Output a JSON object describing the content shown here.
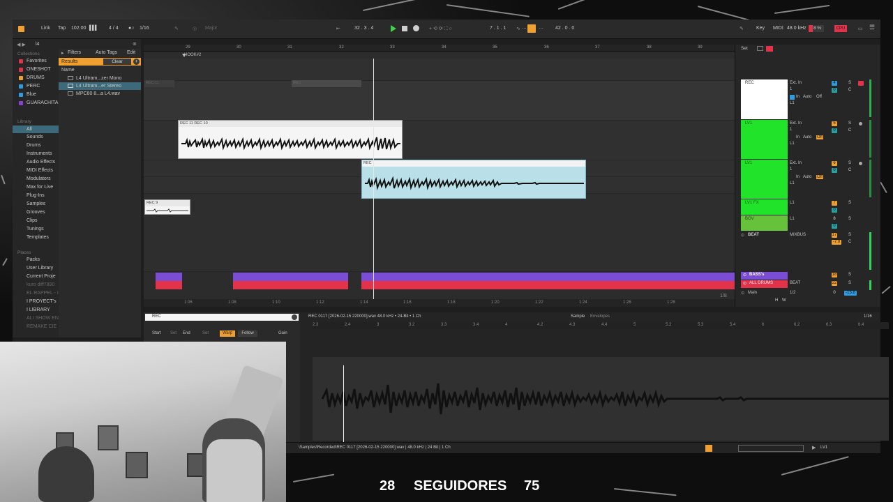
{
  "colors": {
    "accent_orange": "#f0a030",
    "play_green": "#3fd24a",
    "clip_selected_blue": "#b9dfe8",
    "track_white": "#ffffff",
    "track_green": "#21e32a",
    "track_green_dim": "#65c23a",
    "bass_purple": "#7b4cd4",
    "drums_red": "#e2334a",
    "meter_green": "#2fd25a"
  },
  "transport": {
    "link": "Link",
    "tap": "Tap",
    "tempo": "102.00",
    "signature": "4 / 4",
    "quantize": "1/16",
    "key": "Major",
    "position": "32 .  3 .  4",
    "loop_start": "7 .  1 .  1",
    "loop_len": "42 .  0 .  0",
    "key_label": "Key",
    "midi_label": "MIDI",
    "sample_rate": "48.0 kHz",
    "cpu": "8 %",
    "cpu_label": "CPU"
  },
  "browser": {
    "search": "l4",
    "collections_label": "Collections",
    "collections": [
      {
        "label": "Favorites",
        "color": "#e2334a"
      },
      {
        "label": "ONESHOT",
        "color": "#e2334a"
      },
      {
        "label": "DRUMS",
        "color": "#f0a030"
      },
      {
        "label": "PERC",
        "color": "#2d9de0"
      },
      {
        "label": "Blue",
        "color": "#2d9de0"
      },
      {
        "label": "GUARACHITA",
        "color": "#8a3fd0"
      }
    ],
    "library_label": "Library",
    "library": [
      "All",
      "Sounds",
      "Drums",
      "Instruments",
      "Audio Effects",
      "MIDI Effects",
      "Modulators",
      "Max for Live",
      "Plug-Ins",
      "Samples",
      "Grooves",
      "Clips",
      "Tunings",
      "Templates"
    ],
    "places_label": "Places",
    "places": [
      "Packs",
      "User Library",
      "Current Proje",
      "kuro diff7890",
      "EL RAPPEL - I",
      "I PROYECT's",
      "I LIBRARY",
      "ALI SHOW EN",
      "REMAKE CIE"
    ],
    "filters": "Filters",
    "auto_tags": "Auto Tags",
    "edit": "Edit",
    "results": "Results",
    "clear": "Clear",
    "name_header": "Name",
    "files": [
      "L4 Ultram...zer Mono",
      "L4 Ultram...er Stereo",
      "MPC60 8...a L4.wav"
    ]
  },
  "arrangement": {
    "bar_numbers": [
      "29",
      "30",
      "31",
      "32",
      "33",
      "34",
      "35",
      "36",
      "37",
      "38",
      "39"
    ],
    "locator": "HOOK#2",
    "time_labels": [
      "1:06",
      "1:08",
      "1:10",
      "1:12",
      "1:14",
      "1:16",
      "1:18",
      "1:20",
      "1:22",
      "1:24",
      "1:26",
      "1:28"
    ],
    "zoom": "1/8",
    "clips": {
      "rec11_ghost": "REC 11",
      "rec_ghost": "REC",
      "rec11_rec10": "REC 11 REC 10",
      "rec_selected": "REC",
      "rec9": "REC 9"
    }
  },
  "mixer": {
    "set_label": "Set",
    "tracks": [
      {
        "name": "REC",
        "input": "Ext. In",
        "ch": "1",
        "num": "4",
        "send": "0",
        "monitor_in": "In",
        "monitor_auto": "Auto",
        "monitor_off": "Off",
        "out": "L1"
      },
      {
        "name": "LV1",
        "input": "Ext. In",
        "ch": "1",
        "num": "5",
        "send": "0",
        "monitor_in": "In",
        "monitor_auto": "Auto",
        "monitor_off": "Off",
        "out": "L1"
      },
      {
        "name": "LV1",
        "input": "Ext. In",
        "ch": "1",
        "num": "6",
        "send": "0",
        "monitor_in": "In",
        "monitor_auto": "Auto",
        "monitor_off": "Off",
        "out": "L1"
      },
      {
        "name": "LV1 FX",
        "input": "L1",
        "num": "7",
        "send": "0"
      },
      {
        "name": "BGV",
        "input": "L1",
        "num": "8",
        "send": "0"
      },
      {
        "name": "BEAT",
        "input": "MIXBUS",
        "num": "17",
        "send": "-7.0"
      },
      {
        "name": "BASS's",
        "num": "18",
        "send": "0"
      },
      {
        "name": "ALL DRUMS",
        "input": "BEAT",
        "num": "22",
        "send": "0"
      }
    ],
    "main": "Main",
    "main_out": "1/2",
    "main_vol": "0",
    "main_pk": "-15.8",
    "h": "H",
    "w": "W"
  },
  "detail": {
    "clip_name": "REC",
    "file_info": "REC 0117 [2026-02-15 220000].wav  48.0 kHz • 24-Bit • 1 Ch",
    "tab_sample": "Sample",
    "tab_envelopes": "Envelopes",
    "grid": "1/16",
    "start": "Start",
    "set": "Set",
    "end": "End",
    "warp": "Warp",
    "follow": "Follow",
    "gain": "Gain",
    "ruler": [
      "2.3",
      "2.4",
      "3",
      "3.2",
      "3.3",
      "3.4",
      "4",
      "4.2",
      "4.3",
      "4.4",
      "5",
      "5.2",
      "5.3",
      "5.4",
      "6",
      "6.2",
      "6.3",
      "6.4"
    ],
    "path": "\\Samples\\Recorded\\REC 0117 [2026-02-15 220000].wav | 48.0 kHz | 24 Bit | 1 Ch",
    "status_track": "LV1"
  },
  "overlay": {
    "followers_left": "28",
    "followers_label": "SEGUIDORES",
    "followers_right": "75"
  }
}
